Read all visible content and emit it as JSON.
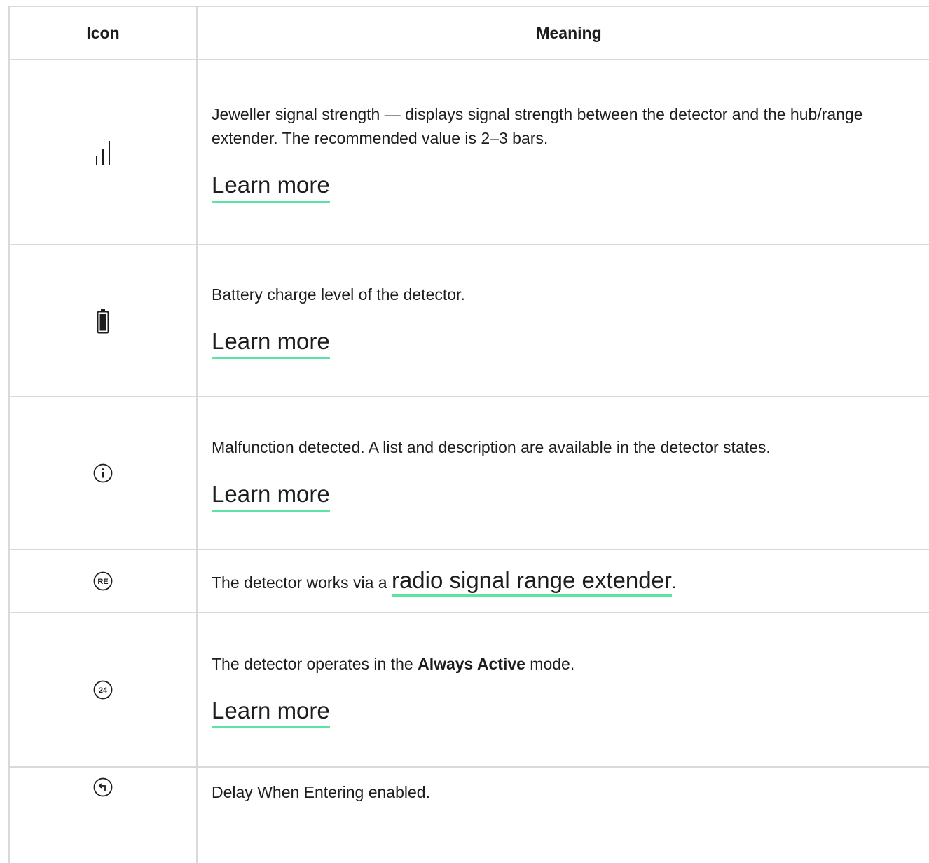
{
  "table": {
    "headers": {
      "icon": "Icon",
      "meaning": "Meaning"
    },
    "rows": [
      {
        "icon": "signal-strength-icon",
        "description": "Jeweller signal strength — displays signal strength between the detector and the hub/range extender. The recommended value is 2–3 bars.",
        "link": "Learn more"
      },
      {
        "icon": "battery-icon",
        "description": "Battery charge level of the detector.",
        "link": "Learn more"
      },
      {
        "icon": "info-icon",
        "description": "Malfunction detected. A list and description are available in the detector states.",
        "link": "Learn more"
      },
      {
        "icon": "range-extender-icon",
        "icon_text": "RE",
        "description_before": "The detector works via a ",
        "link": "radio signal range extender",
        "description_after": "."
      },
      {
        "icon": "always-active-icon",
        "icon_text": "24",
        "description_before": "The detector operates in the ",
        "description_bold": "Always Active",
        "description_after": " mode.",
        "link": "Learn more"
      },
      {
        "icon": "delay-entering-icon",
        "description": "Delay When Entering enabled."
      }
    ]
  },
  "colors": {
    "link_underline": "#5ee3a5",
    "border": "#d9d9d9",
    "text": "#1d1d1d"
  }
}
